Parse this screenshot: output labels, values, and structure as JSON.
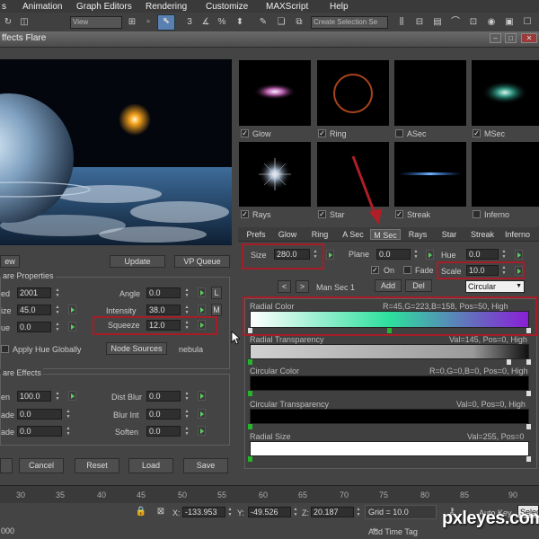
{
  "menu": [
    "s",
    "Animation",
    "Graph Editors",
    "Rendering",
    "Customize",
    "MAXScript",
    "Help"
  ],
  "toolbar": {
    "view_select": "View",
    "selection_set": "Create Selection Se"
  },
  "window": {
    "title": "ffects Flare"
  },
  "preview_buttons": {
    "view": "ew",
    "update": "Update",
    "vp_queue": "VP Queue"
  },
  "flare_props": {
    "title": "are Properties",
    "seed_label": "ed",
    "seed": "2001",
    "size_label": "ize",
    "size": "45.0",
    "hue_label": "ue",
    "hue": "0.0",
    "angle_label": "Angle",
    "angle": "0.0",
    "intensity_label": "Intensity",
    "intensity": "38.0",
    "squeeze_label": "Squeeze",
    "squeeze": "12.0",
    "l_btn": "L",
    "m_btn": "M",
    "apply_hue": "Apply Hue Globally",
    "node_sources": "Node Sources",
    "node_name": "nebula"
  },
  "flare_effects": {
    "title": "are Effects",
    "brighten_label": "en",
    "brighten": "100.0",
    "fade1_label": "ade",
    "fade1": "0.0",
    "fade2_label": "ade",
    "fade2": "0.0",
    "dist_blur_label": "Dist Blur",
    "dist_blur": "0.0",
    "blur_int_label": "Blur Int",
    "blur_int": "0.0",
    "soften_label": "Soften",
    "soften": "0.0"
  },
  "bottom_buttons": [
    "Cancel",
    "Reset",
    "Load",
    "Save"
  ],
  "thumbnails": [
    {
      "label": "Glow",
      "checked": "✓"
    },
    {
      "label": "Ring",
      "checked": "✓"
    },
    {
      "label": "ASec",
      "checked": ""
    },
    {
      "label": "MSec",
      "checked": "✓"
    },
    {
      "label": "Rays",
      "checked": "✓"
    },
    {
      "label": "Star",
      "checked": "✓"
    },
    {
      "label": "Streak",
      "checked": "✓"
    },
    {
      "label": "Inferno",
      "checked": ""
    }
  ],
  "tabs": [
    "Prefs",
    "Glow",
    "Ring",
    "A Sec",
    "M Sec",
    "Rays",
    "Star",
    "Streak",
    "Inferno"
  ],
  "msec": {
    "size_label": "Size",
    "size": "280.0",
    "plane_label": "Plane",
    "plane": "0.0",
    "hue_label": "Hue",
    "hue": "0.0",
    "on_label": "On",
    "fade_label": "Fade",
    "scale_label": "Scale",
    "scale": "10.0",
    "prev": "<",
    "next": ">",
    "man_sec": "Man Sec 1",
    "add": "Add",
    "del": "Del",
    "shape": "Circular"
  },
  "gradients": [
    {
      "label": "Radial Color",
      "info": "R=45,G=223,B=158, Pos=50, High"
    },
    {
      "label": "Radial Transparency",
      "info": "Val=145, Pos=0, High"
    },
    {
      "label": "Circular Color",
      "info": "R=0,G=0,B=0, Pos=0, High"
    },
    {
      "label": "Circular Transparency",
      "info": "Val=0, Pos=0, High"
    },
    {
      "label": "Radial Size",
      "info": "Val=255, Pos=0"
    }
  ],
  "timeline_ticks": [
    "30",
    "35",
    "40",
    "45",
    "50",
    "55",
    "60",
    "65",
    "70",
    "75",
    "80",
    "85",
    "90"
  ],
  "status": {
    "x_label": "X:",
    "x": "-133.953",
    "y_label": "Y:",
    "y": "-49.526",
    "z_label": "Z:",
    "z": "20.187",
    "grid": "Grid = 10.0",
    "auto_key": "Auto Key",
    "select": "Selec",
    "add_time_tag": "Add Time Tag",
    "left_text": "000"
  },
  "watermark": "pxleyes.com",
  "colors": {
    "accent_red": "#a71d27",
    "green_arrow": "#57d15e",
    "radial_start": "#ffffff",
    "radial_mid": "#2ddf9e",
    "radial_end": "#8a1fd6"
  }
}
